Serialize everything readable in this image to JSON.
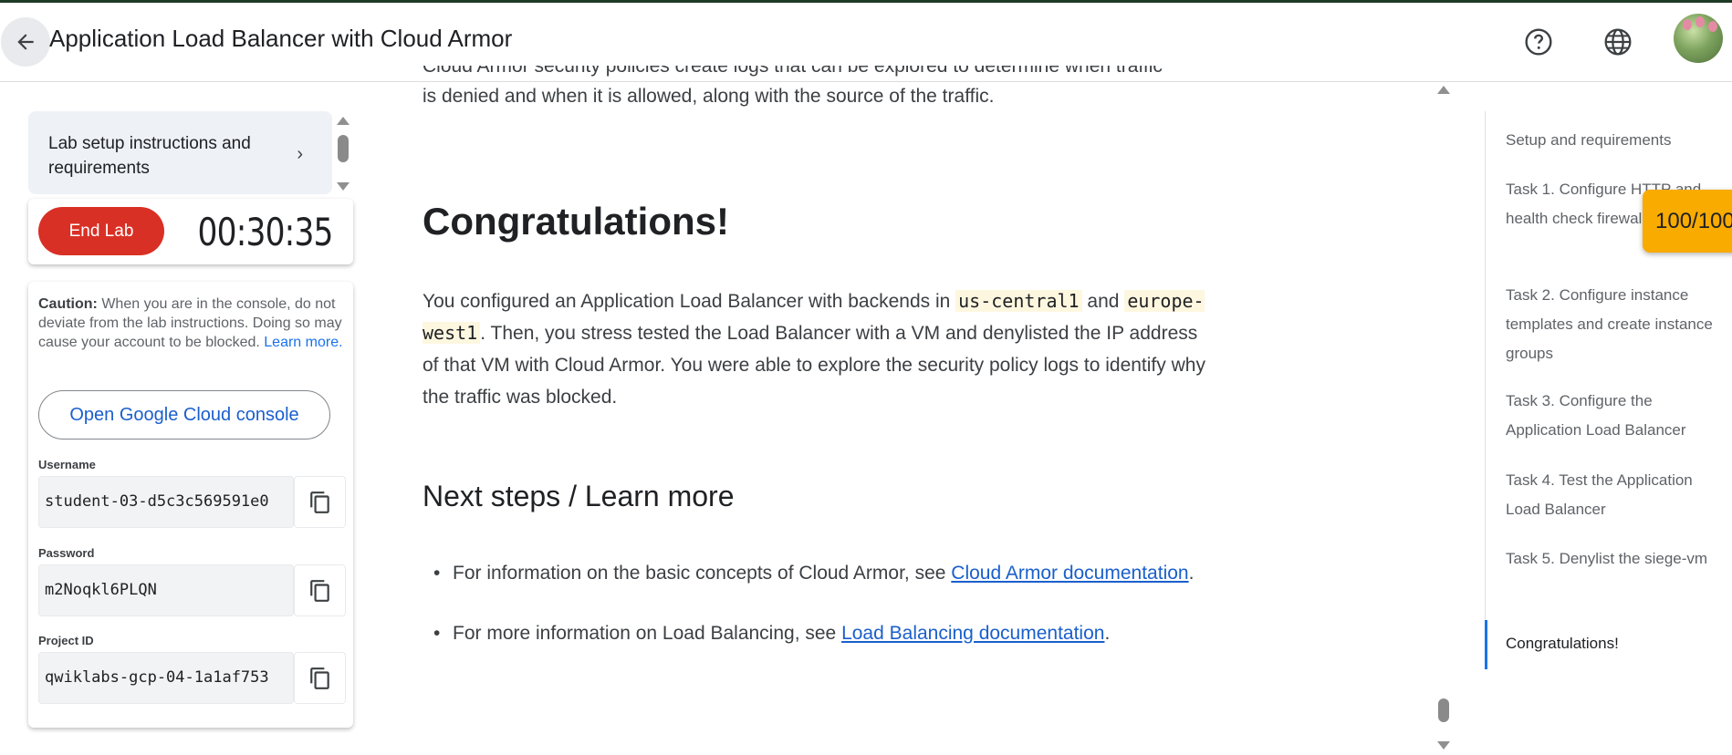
{
  "header": {
    "title": "Application Load Balancer with Cloud Armor",
    "icons": [
      "back-arrow-icon",
      "help-icon",
      "globe-icon",
      "avatar"
    ]
  },
  "left_panel": {
    "setup_card_label": "Lab setup instructions and requirements",
    "end_lab_label": "End Lab",
    "timer": "00:30:35",
    "caution_label": "Caution:",
    "caution_text": " When you are in the console, do not deviate from the lab instructions. Doing so may cause your account to be blocked. ",
    "learn_more": "Learn more.",
    "open_console_label": "Open Google Cloud console",
    "username_label": "Username",
    "username_value": "student-03-d5c3c569591e0",
    "password_label": "Password",
    "password_value": "m2Noqkl6PLQN",
    "project_label": "Project ID",
    "project_value": "qwiklabs-gcp-04-1a1af753"
  },
  "content": {
    "intro_line1": "Cloud Armor security policies create logs that can be explored to determine when traffic",
    "intro_line2": "is denied and when it is allowed, along with the source of the traffic.",
    "congrats_heading": "Congratulations!",
    "para_1": "You configured an Application Load Balancer with backends in ",
    "code_1": "us-central1",
    "para_2": " and ",
    "code_2": "europe-west1",
    "para_3": ". Then, you stress tested the Load Balancer with a VM and denylisted the IP address of that VM with Cloud Armor. You were able to explore the security policy logs to identify why the traffic was blocked.",
    "next_heading": "Next steps / Learn more",
    "bullet_1_text": "For information on the basic concepts of Cloud Armor, see ",
    "bullet_1_link": "Cloud Armor documentation",
    "bullet_1_end": ".",
    "bullet_2_text": "For more information on Load Balancing, see ",
    "bullet_2_link": "Load Balancing documentation",
    "bullet_2_end": "."
  },
  "toc": {
    "items": [
      "Setup and requirements",
      "Task 1. Configure HTTP and health check firewall rules",
      "Task 2. Configure instance templates and create instance groups",
      "Task 3. Configure the Application Load Balancer",
      "Task 4. Test the Application Load Balancer",
      "Task 5. Denylist the siege-vm",
      "Congratulations!"
    ],
    "active_index": 6
  },
  "score": "100/100"
}
